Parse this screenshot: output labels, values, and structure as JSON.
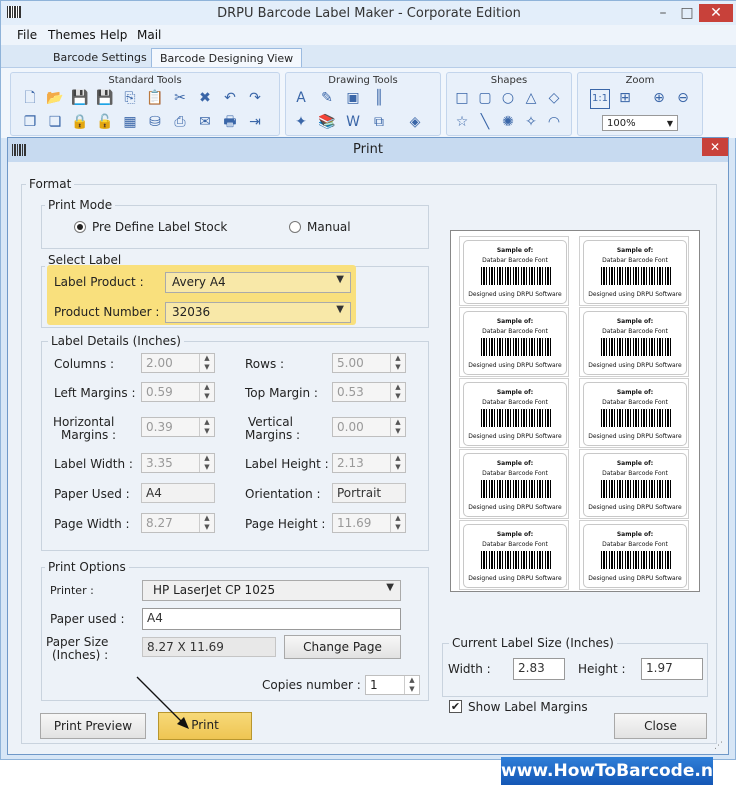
{
  "app": {
    "title": "DRPU Barcode Label Maker - Corporate Edition",
    "minimize": "–",
    "restore": "□",
    "close": "✕"
  },
  "menu": [
    "File",
    "Themes",
    "Help",
    "Mail"
  ],
  "tabs": [
    "Barcode Settings",
    "Barcode Designing View"
  ],
  "ribbon": {
    "groups": [
      "Standard Tools",
      "Drawing Tools",
      "Shapes",
      "Zoom"
    ],
    "zoom_value": "100%"
  },
  "dialog": {
    "title": "Print",
    "close": "✕",
    "format_legend": "Format",
    "print_mode": {
      "legend": "Print Mode",
      "option1": "Pre Define Label Stock",
      "option2": "Manual",
      "selected": "Pre Define Label Stock"
    },
    "select_label": {
      "legend": "Select Label",
      "product_label": "Label Product :",
      "product_value": "Avery A4",
      "number_label": "Product Number :",
      "number_value": "32036"
    },
    "label_details": {
      "legend": "Label Details (Inches)",
      "columns_label": "Columns :",
      "columns_value": "2.00",
      "rows_label": "Rows :",
      "rows_value": "5.00",
      "left_margins_label": "Left Margins :",
      "left_margins_value": "0.59",
      "top_margin_label": "Top Margin :",
      "top_margin_value": "0.53",
      "hmargins_label1": "Horizontal",
      "hmargins_label2": "Margins :",
      "hmargins_value": "0.39",
      "vmargins_label1": "Vertical",
      "vmargins_label2": "Margins :",
      "vmargins_value": "0.00",
      "label_width_label": "Label Width :",
      "label_width_value": "3.35",
      "label_height_label": "Label Height :",
      "label_height_value": "2.13",
      "paper_used_label": "Paper Used :",
      "paper_used_value": "A4",
      "orientation_label": "Orientation :",
      "orientation_value": "Portrait",
      "page_width_label": "Page Width :",
      "page_width_value": "8.27",
      "page_height_label": "Page Height :",
      "page_height_value": "11.69"
    },
    "print_options": {
      "legend": "Print Options",
      "printer_label": "Printer :",
      "printer_value": "HP LaserJet CP 1025",
      "paper_used_label": "Paper used :",
      "paper_used_value": "A4",
      "paper_size_label1": "Paper Size",
      "paper_size_label2": "(Inches) :",
      "paper_size_value": "8.27 X 11.69",
      "change_page": "Change Page",
      "copies_label": "Copies number :",
      "copies_value": "1"
    },
    "preview_label": {
      "line1": "Sample of:",
      "line2": "Databar Barcode Font",
      "line3": "Designed using DRPU Software"
    },
    "current_size": {
      "legend": "Current Label Size (Inches)",
      "width_label": "Width :",
      "width_value": "2.83",
      "height_label": "Height :",
      "height_value": "1.97"
    },
    "show_margins": "Show Label Margins",
    "show_margins_checked": true,
    "print_preview": "Print Preview",
    "print": "Print",
    "close_button": "Close"
  },
  "watermark": "www.HowToBarcode.net",
  "colors": {
    "highlight": "#f9e07d",
    "print_button": "#f2cf63",
    "watermark_bg": "#1f66c4"
  }
}
